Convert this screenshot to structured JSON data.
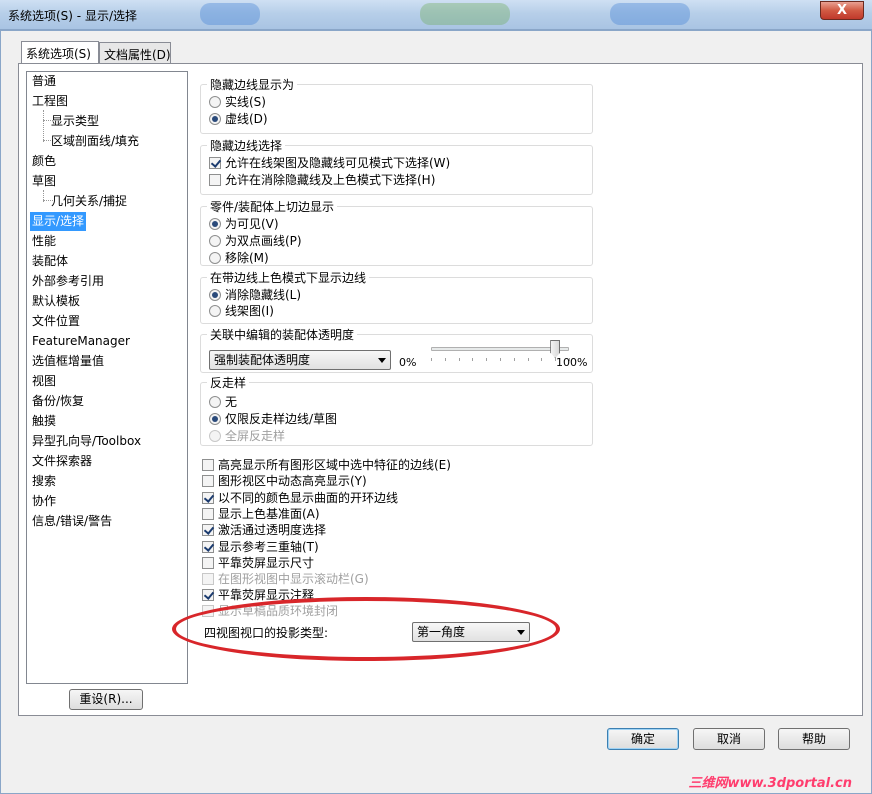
{
  "window": {
    "title": "系统选项(S) - 显示/选择",
    "close_glyph": "X"
  },
  "tabs": [
    {
      "label": "系统选项(S)"
    },
    {
      "label": "文档属性(D)"
    }
  ],
  "tree": {
    "items": [
      {
        "label": "普通"
      },
      {
        "label": "工程图"
      },
      {
        "label": "显示类型"
      },
      {
        "label": "区域剖面线/填充"
      },
      {
        "label": "颜色"
      },
      {
        "label": "草图"
      },
      {
        "label": "几何关系/捕捉"
      },
      {
        "label": "显示/选择"
      },
      {
        "label": "性能"
      },
      {
        "label": "装配体"
      },
      {
        "label": "外部参考引用"
      },
      {
        "label": "默认模板"
      },
      {
        "label": "文件位置"
      },
      {
        "label": "FeatureManager"
      },
      {
        "label": "选值框增量值"
      },
      {
        "label": "视图"
      },
      {
        "label": "备份/恢复"
      },
      {
        "label": "触摸"
      },
      {
        "label": "异型孔向导/Toolbox"
      },
      {
        "label": "文件探索器"
      },
      {
        "label": "搜索"
      },
      {
        "label": "协作"
      },
      {
        "label": "信息/错误/警告"
      }
    ],
    "reset_label": "重设(R)..."
  },
  "hidden_edges": {
    "title": "隐藏边线显示为",
    "options": [
      {
        "label": "实线(S)",
        "selected": false
      },
      {
        "label": "虚线(D)",
        "selected": true
      }
    ]
  },
  "hidden_edge_select": {
    "title": "隐藏边线选择",
    "options": [
      {
        "label": "允许在线架图及隐藏线可见模式下选择(W)",
        "checked": true
      },
      {
        "label": "允许在消除隐藏线及上色模式下选择(H)",
        "checked": false
      }
    ]
  },
  "tangent_edges": {
    "title": "零件/装配体上切边显示",
    "options": [
      {
        "label": "为可见(V)",
        "selected": true
      },
      {
        "label": "为双点画线(P)",
        "selected": false
      },
      {
        "label": "移除(M)",
        "selected": false
      }
    ]
  },
  "shaded_edges": {
    "title": "在带边线上色模式下显示边线",
    "options": [
      {
        "label": "消除隐藏线(L)",
        "selected": true
      },
      {
        "label": "线架图(I)",
        "selected": false
      }
    ]
  },
  "transparency": {
    "title": "关联中编辑的装配体透明度",
    "selected": "强制装配体透明度",
    "min_label": "0%",
    "max_label": "100%",
    "value": 0.9
  },
  "antialias": {
    "title": "反走样",
    "options": [
      {
        "label": "无",
        "selected": false,
        "disabled": false
      },
      {
        "label": "仅限反走样边线/草图",
        "selected": true,
        "disabled": false
      },
      {
        "label": "全屏反走样",
        "selected": false,
        "disabled": true
      }
    ]
  },
  "checks": [
    {
      "label": "高亮显示所有图形区域中选中特征的边线(E)",
      "checked": false,
      "disabled": false
    },
    {
      "label": "图形视区中动态高亮显示(Y)",
      "checked": false,
      "disabled": false
    },
    {
      "label": "以不同的颜色显示曲面的开环边线",
      "checked": true,
      "disabled": false
    },
    {
      "label": "显示上色基准面(A)",
      "checked": false,
      "disabled": false
    },
    {
      "label": "激活通过透明度选择",
      "checked": true,
      "disabled": false
    },
    {
      "label": "显示参考三重轴(T)",
      "checked": true,
      "disabled": false
    },
    {
      "label": "平靠荧屏显示尺寸",
      "checked": false,
      "disabled": false
    },
    {
      "label": "在图形视图中显示滚动栏(G)",
      "checked": false,
      "disabled": true
    },
    {
      "label": "平靠荧屏显示注释",
      "checked": true,
      "disabled": false
    },
    {
      "label": "显示草稿品质环境封闭",
      "checked": false,
      "disabled": true
    }
  ],
  "projection": {
    "label": "四视图视口的投影类型:",
    "selected": "第一角度"
  },
  "buttons": {
    "ok": "确定",
    "cancel": "取消",
    "help": "帮助"
  },
  "watermark": "三维网www.3dportal.cn",
  "colors": {
    "selection": "#3399ff",
    "highlight_ellipse": "#d8262a",
    "watermark": "#ff3d6e"
  }
}
